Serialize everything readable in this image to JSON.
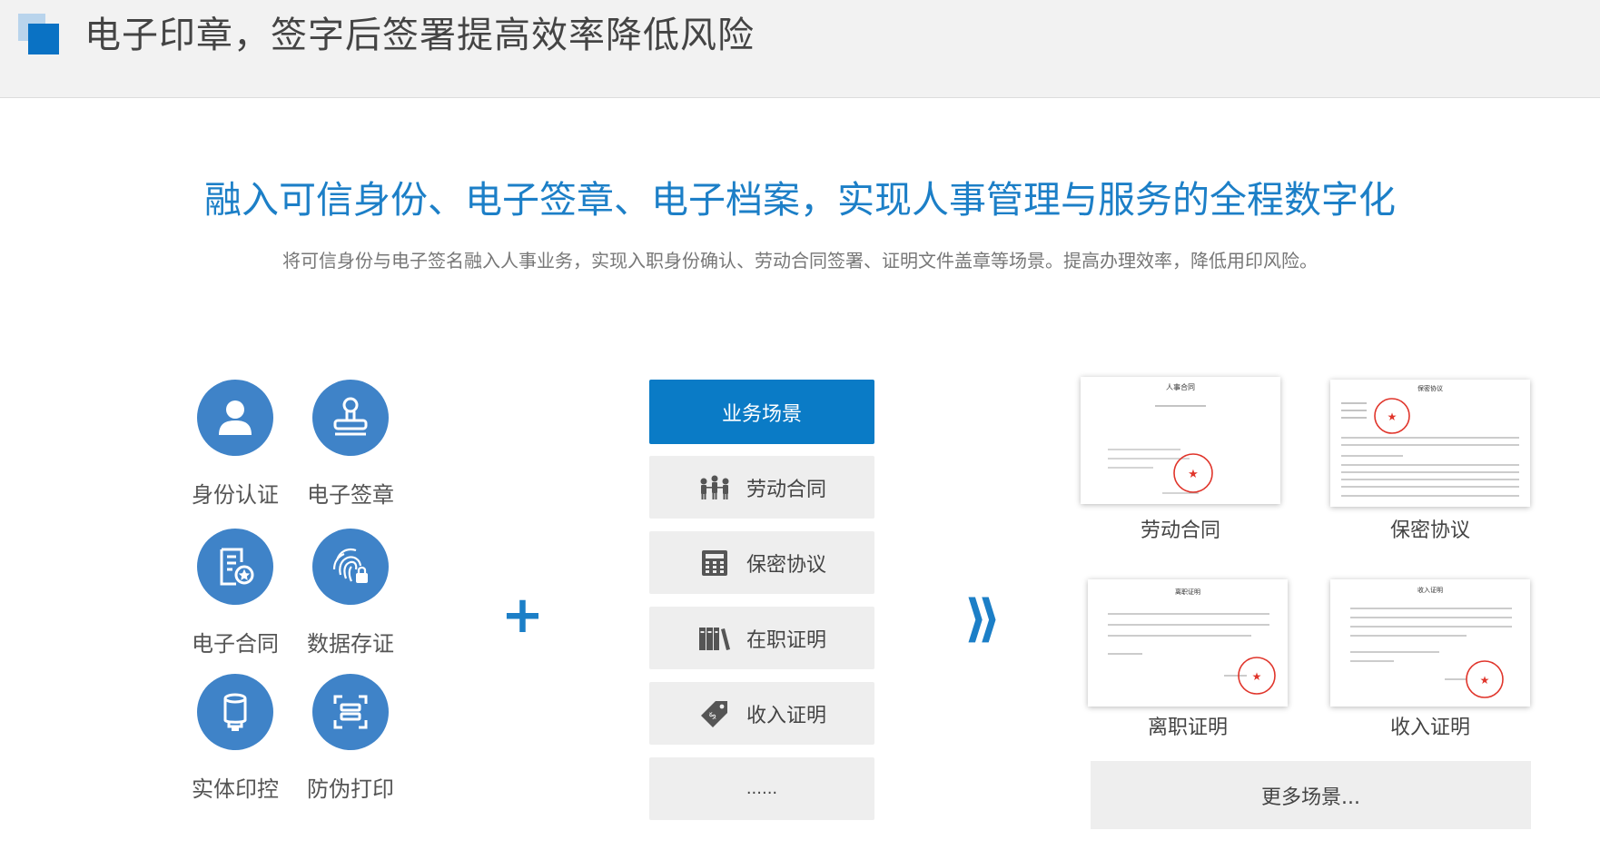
{
  "header": {
    "title": "电子印章，签字后签署提高效率降低风险"
  },
  "hero": {
    "title": "融入可信身份、电子签章、电子档案，实现人事管理与服务的全程数字化",
    "subtitle": "将可信身份与电子签名融入人事业务，实现入职身份确认、劳动合同签署、证明文件盖章等场景。提高办理效率，降低用印风险。"
  },
  "features": [
    {
      "label": "身份认证",
      "icon": "user-icon"
    },
    {
      "label": "电子签章",
      "icon": "seal-icon"
    },
    {
      "label": "电子合同",
      "icon": "contract-icon"
    },
    {
      "label": "数据存证",
      "icon": "fingerprint-icon"
    },
    {
      "label": "实体印控",
      "icon": "stamp-device-icon"
    },
    {
      "label": "防伪打印",
      "icon": "print-frame-icon"
    }
  ],
  "plus_symbol": "+",
  "scenes": {
    "header": "业务场景",
    "items": [
      {
        "label": "劳动合同",
        "icon": "people-icon"
      },
      {
        "label": "保密协议",
        "icon": "calculator-icon"
      },
      {
        "label": "在职证明",
        "icon": "books-icon"
      },
      {
        "label": "收入证明",
        "icon": "money-tag-icon"
      },
      {
        "label": "......",
        "icon": ""
      }
    ]
  },
  "arrow_symbol": "⟫",
  "documents": [
    {
      "caption": "劳动合同",
      "doc_title": "人事合同"
    },
    {
      "caption": "保密协议",
      "doc_title": "保密协议"
    },
    {
      "caption": "离职证明",
      "doc_title": "离职证明"
    },
    {
      "caption": "收入证明",
      "doc_title": "收入证明"
    }
  ],
  "more_label": "更多场景...",
  "colors": {
    "accent": "#1c7fc7",
    "icon_circle": "#3f83c8",
    "seal_red": "#e0352b"
  }
}
